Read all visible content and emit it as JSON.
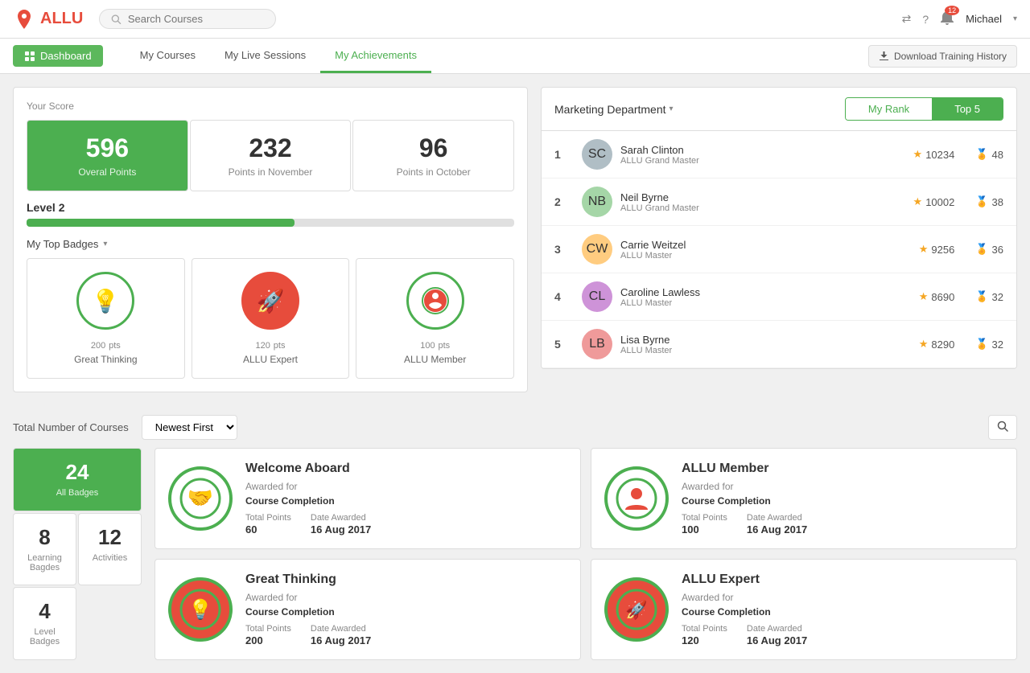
{
  "app": {
    "logo_text": "ALLU",
    "search_placeholder": "Search Courses"
  },
  "header": {
    "notif_count": "12",
    "user_name": "Michael",
    "download_btn": "Download Training History"
  },
  "navbar": {
    "dashboard_label": "Dashboard",
    "links": [
      {
        "label": "My Courses",
        "active": false
      },
      {
        "label": "My Live Sessions",
        "active": false
      },
      {
        "label": "My Achievements",
        "active": true
      }
    ]
  },
  "scores": {
    "label": "Your Score",
    "cards": [
      {
        "value": "596",
        "label": "Overal Points",
        "primary": true
      },
      {
        "value": "232",
        "label": "Points in November",
        "primary": false
      },
      {
        "value": "96",
        "label": "Points in October",
        "primary": false
      }
    ]
  },
  "level": {
    "text": "Level 2",
    "progress": 55
  },
  "badges": {
    "label": "My Top Badges",
    "items": [
      {
        "pts": "200",
        "name": "Great Thinking",
        "icon": "💡",
        "style": "green"
      },
      {
        "pts": "120",
        "name": "ALLU Expert",
        "icon": "🚀",
        "style": "red"
      },
      {
        "pts": "100",
        "name": "ALLU Member",
        "icon": "📍",
        "style": "teal"
      }
    ]
  },
  "leaderboard": {
    "dept": "Marketing Department",
    "tab_my_rank": "My Rank",
    "tab_top5": "Top 5",
    "rows": [
      {
        "rank": "1",
        "name": "Sarah Clinton",
        "title": "ALLU Grand Master",
        "score": "10234",
        "badges": "48",
        "avatar": "SC"
      },
      {
        "rank": "2",
        "name": "Neil Byrne",
        "title": "ALLU Grand Master",
        "score": "10002",
        "badges": "38",
        "avatar": "NB"
      },
      {
        "rank": "3",
        "name": "Carrie Weitzel",
        "title": "ALLU Master",
        "score": "9256",
        "badges": "36",
        "avatar": "CW"
      },
      {
        "rank": "4",
        "name": "Caroline Lawless",
        "title": "ALLU Master",
        "score": "8690",
        "badges": "32",
        "avatar": "CL"
      },
      {
        "rank": "5",
        "name": "Lisa Byrne",
        "title": "ALLU Master",
        "score": "8290",
        "badges": "32",
        "avatar": "LB"
      }
    ]
  },
  "bottom": {
    "total_label": "Total Number of Courses",
    "sort_label": "Newest First",
    "stats": [
      {
        "value": "24",
        "label": "All Badges",
        "primary": true
      },
      {
        "value": "8",
        "label": "Learning Bagdes",
        "primary": false
      },
      {
        "value": "12",
        "label": "Activities",
        "primary": false
      },
      {
        "value": "4",
        "label": "Level Badges",
        "primary": false
      }
    ],
    "badge_cards": [
      {
        "title": "Welcome Aboard",
        "awarded_for_label": "Awarded for",
        "awarded_for": "Course Completion",
        "points_label": "Total Points",
        "points": "60",
        "date_label": "Date Awarded",
        "date": "16 Aug 2017",
        "icon": "🤝",
        "icon_style": "green"
      },
      {
        "title": "ALLU Member",
        "awarded_for_label": "Awarded for",
        "awarded_for": "Course Completion",
        "points_label": "Total Points",
        "points": "100",
        "date_label": "Date Awarded",
        "date": "16 Aug 2017",
        "icon": "📍",
        "icon_style": "teal"
      },
      {
        "title": "Great Thinking",
        "awarded_for_label": "Awarded for",
        "awarded_for": "Course Completion",
        "points_label": "Total Points",
        "points": "200",
        "date_label": "Date Awarded",
        "date": "16 Aug 2017",
        "icon": "💡",
        "icon_style": "green"
      },
      {
        "title": "ALLU Expert",
        "awarded_for_label": "Awarded for",
        "awarded_for": "Course Completion",
        "points_label": "Total Points",
        "points": "120",
        "date_label": "Date Awarded",
        "date": "16 Aug 2017",
        "icon": "🚀",
        "icon_style": "red"
      }
    ]
  }
}
